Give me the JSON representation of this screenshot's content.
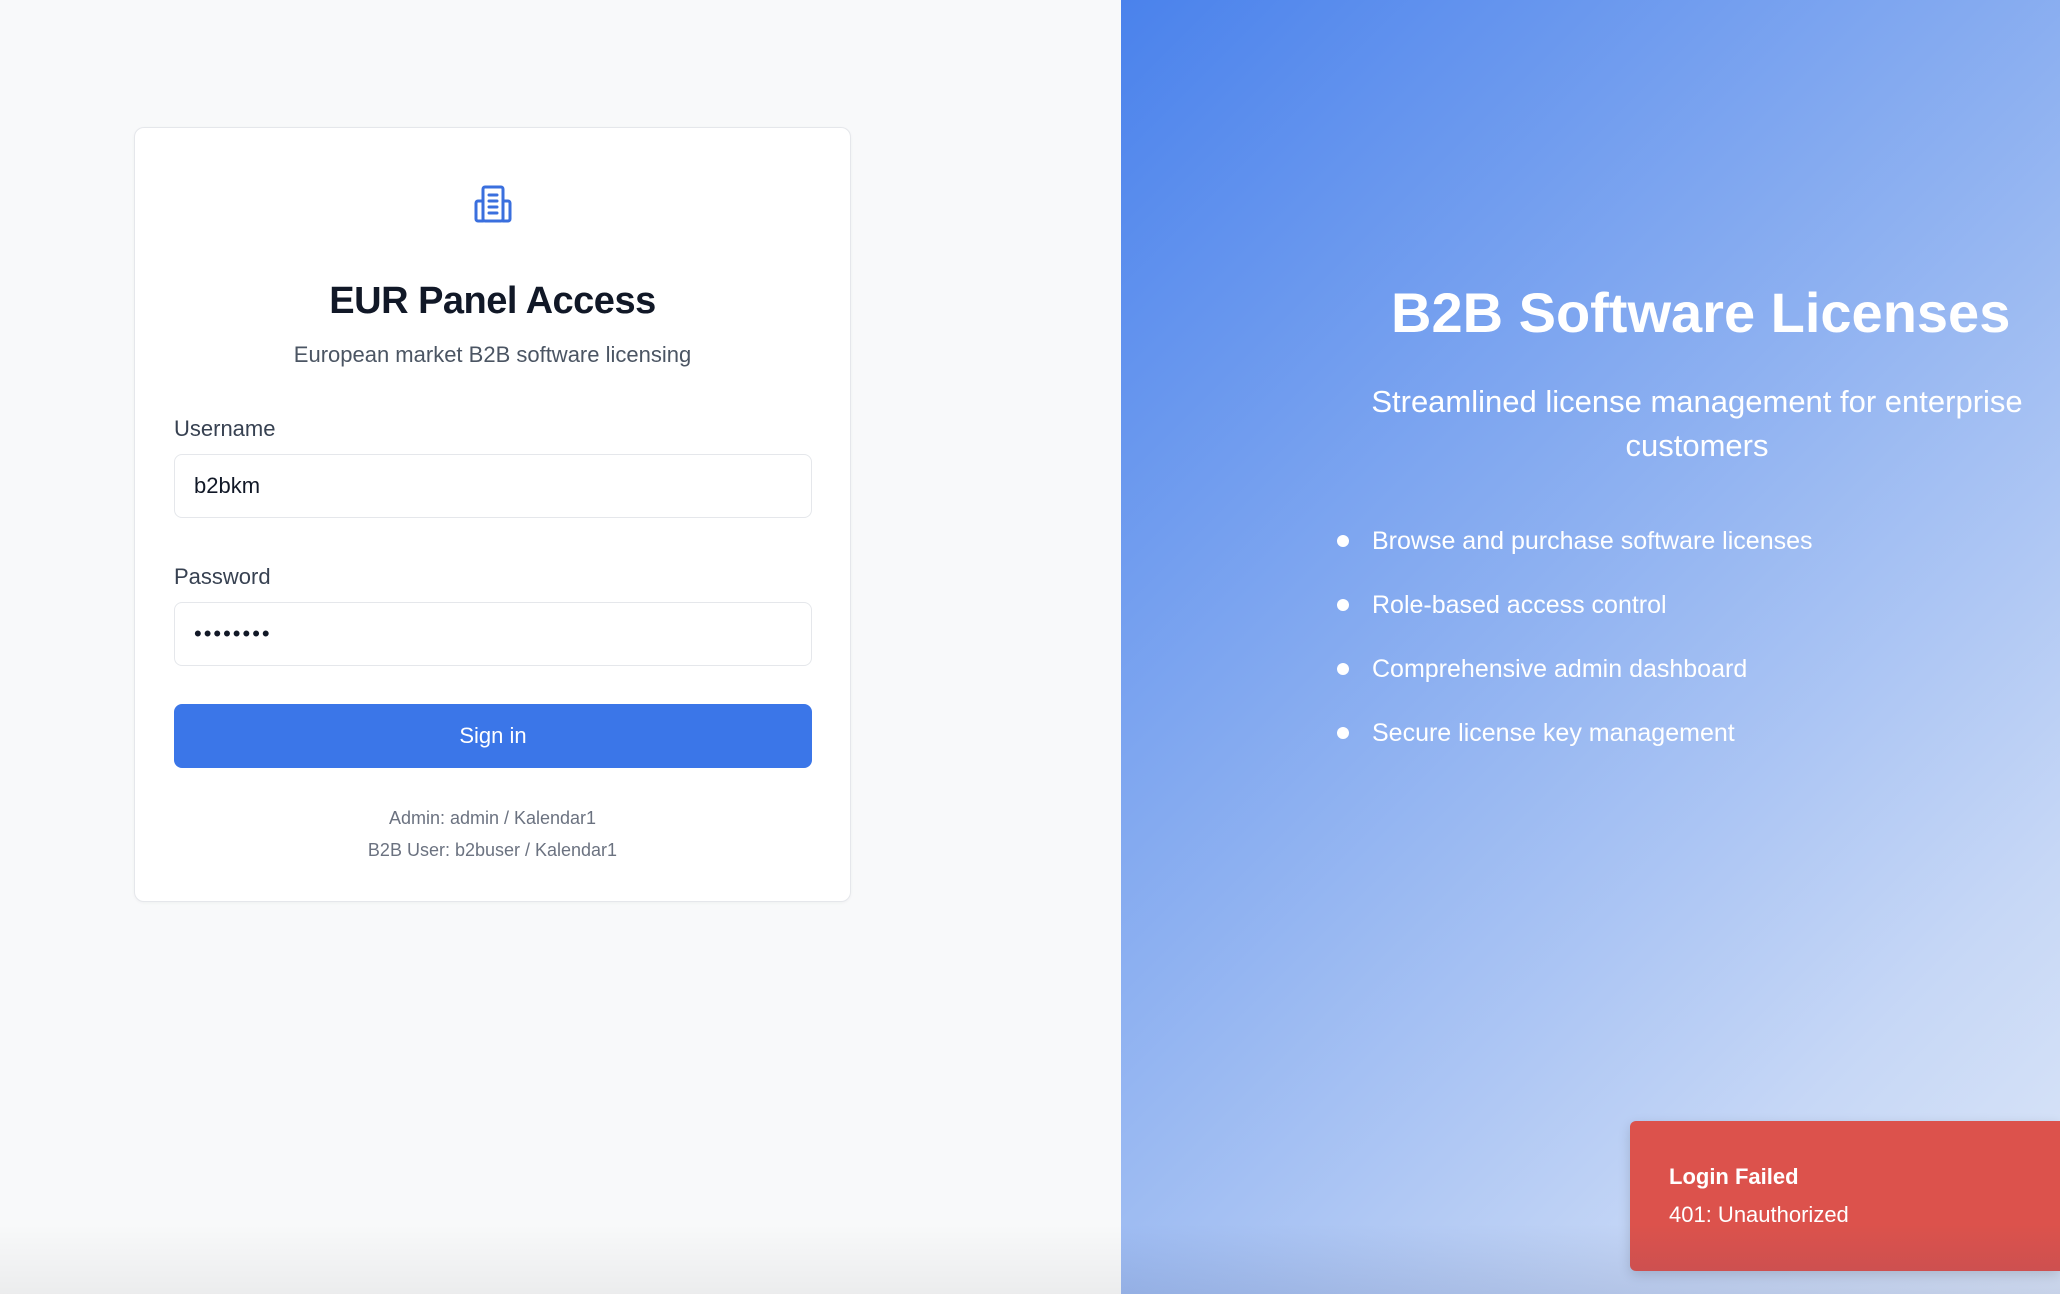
{
  "login_card": {
    "logo_icon": "building-icon",
    "title": "EUR Panel Access",
    "subtitle": "European market B2B software licensing",
    "username_label": "Username",
    "username_value": "b2bkm",
    "password_label": "Password",
    "password_value": "••••••••",
    "signin_label": "Sign in",
    "hints": [
      "Admin: admin / Kalendar1",
      "B2B User: b2buser / Kalendar1"
    ]
  },
  "hero": {
    "title": "B2B Software Licenses",
    "subtitle": "Streamlined license management for enterprise customers",
    "features": [
      "Browse and purchase software licenses",
      "Role-based access control",
      "Comprehensive admin dashboard",
      "Secure license key management"
    ]
  },
  "toast": {
    "title": "Login Failed",
    "message": "401: Unauthorized",
    "color": "#dc524c"
  },
  "colors": {
    "accent": "#3b76e8",
    "hero_gradient_start": "#4a82ec",
    "hero_gradient_end": "#dde7f8"
  }
}
